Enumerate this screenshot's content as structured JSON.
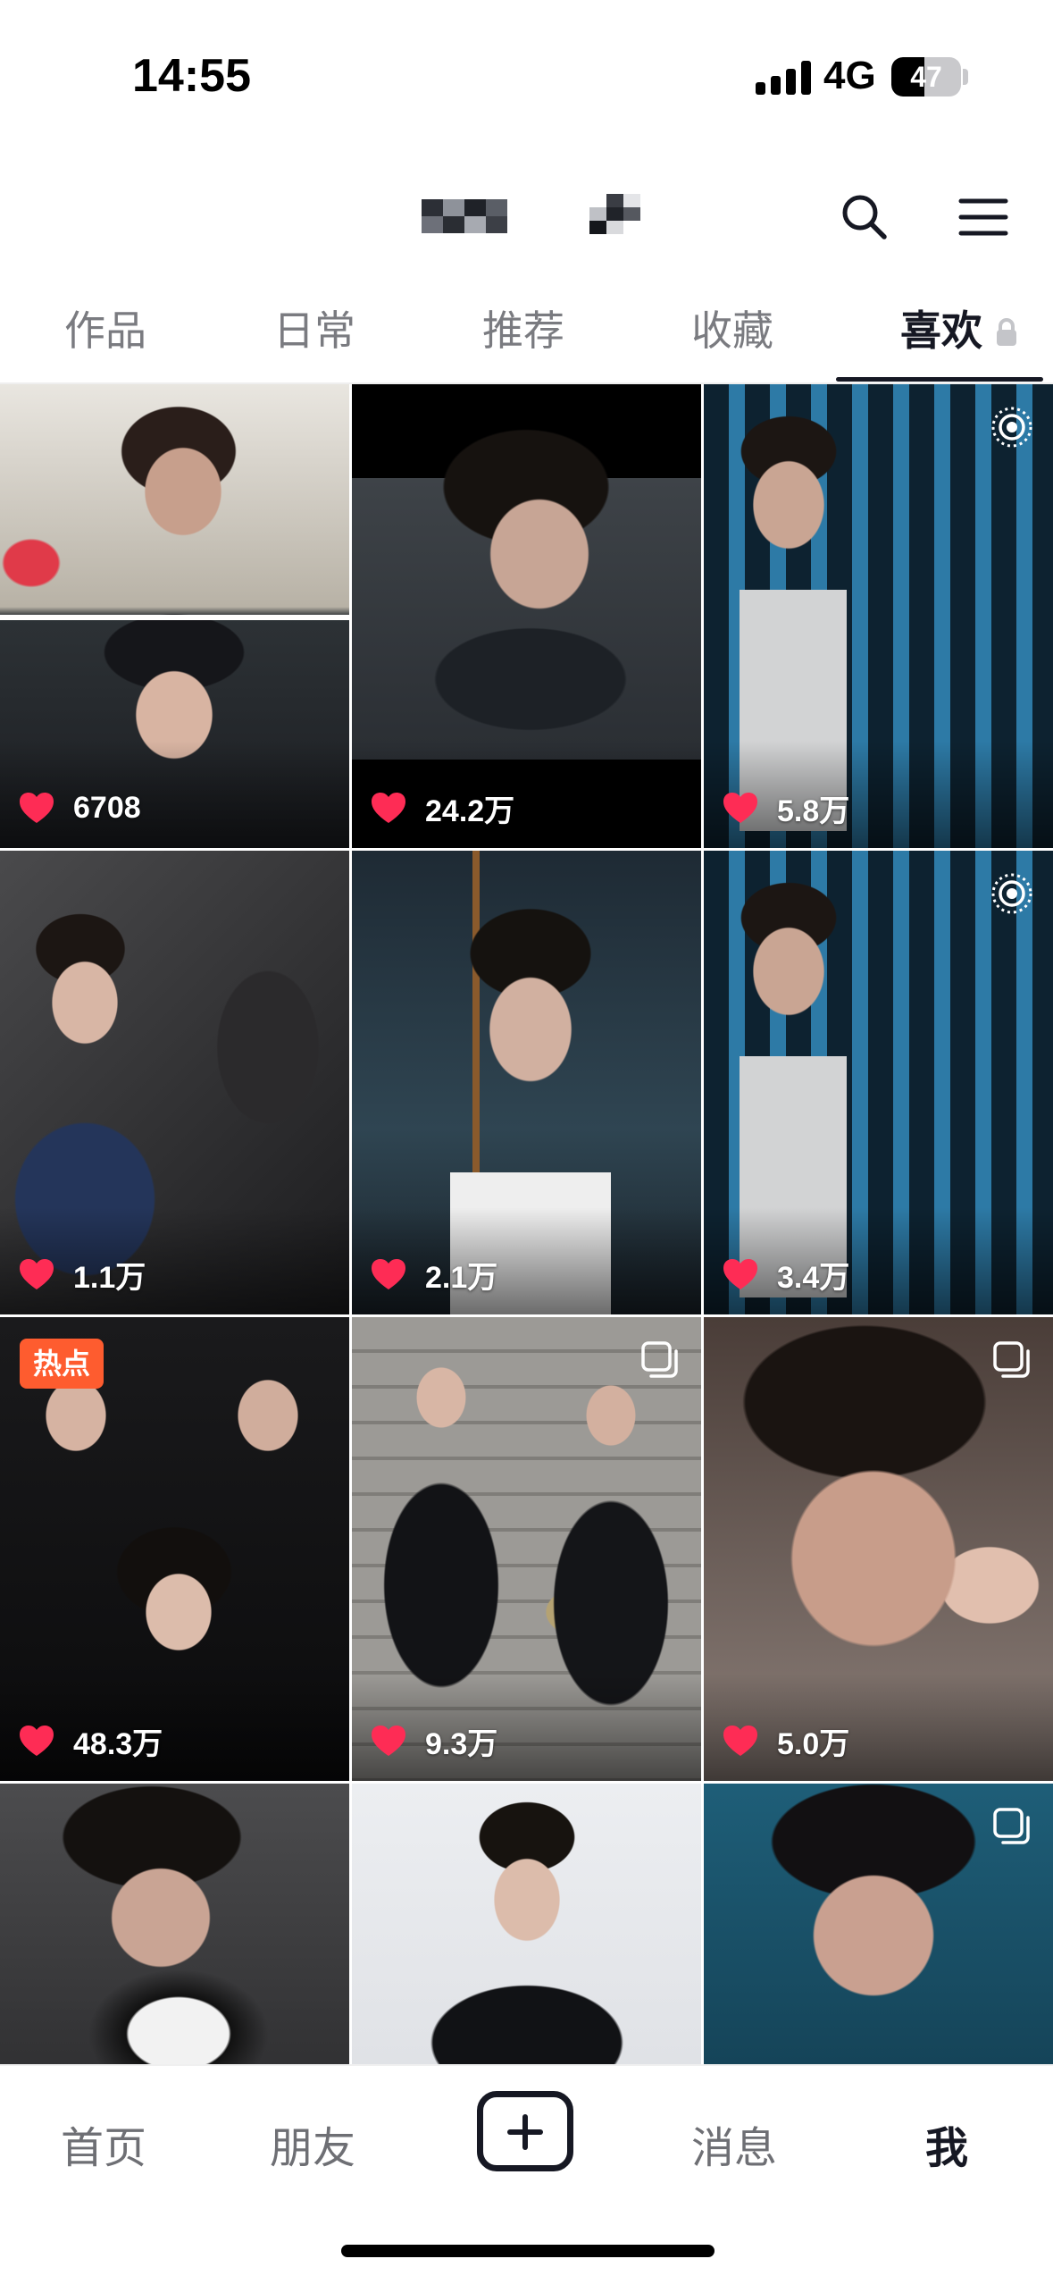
{
  "status_bar": {
    "time": "14:55",
    "network": "4G",
    "battery": "47",
    "battery_level": 0.47
  },
  "header": {
    "icons": [
      "search-icon",
      "menu-icon"
    ]
  },
  "tabs": [
    {
      "label": "作品",
      "active": false
    },
    {
      "label": "日常",
      "active": false
    },
    {
      "label": "推荐",
      "active": false
    },
    {
      "label": "收藏",
      "active": false
    },
    {
      "label": "喜欢",
      "active": true,
      "locked": true
    }
  ],
  "grid": {
    "items": [
      {
        "likes": "6708"
      },
      {
        "likes": "24.2万"
      },
      {
        "likes": "5.8万",
        "badge": "live-icon"
      },
      {
        "likes": "1.1万"
      },
      {
        "likes": "2.1万"
      },
      {
        "likes": "3.4万",
        "badge": "live-icon"
      },
      {
        "likes": "48.3万",
        "tag": "热点"
      },
      {
        "likes": "9.3万",
        "badge": "album-icon"
      },
      {
        "likes": "5.0万",
        "badge": "album-icon"
      },
      {
        "likes": ""
      },
      {
        "likes": ""
      },
      {
        "likes": "",
        "badge": "album-icon"
      }
    ]
  },
  "bottom_nav": {
    "home": "首页",
    "friends": "朋友",
    "messages": "消息",
    "me": "我",
    "active": "我"
  },
  "colors": {
    "heart": "#fe2c55",
    "hot_badge": "#fe5c2f",
    "text_primary": "#161823",
    "text_secondary": "#7a7b80"
  }
}
